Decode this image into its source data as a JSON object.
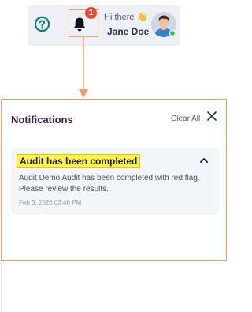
{
  "header": {
    "greeting": "Hi there",
    "user_name": "Jane Doe",
    "notification_count": "1",
    "presence_color": "#2ebf5a",
    "icons": [
      "help-circle-icon",
      "bell-icon",
      "avatar"
    ]
  },
  "notifications": {
    "title": "Notifications",
    "clear_all": "Clear All",
    "items": [
      {
        "title": "Audit has been completed",
        "body": "Audit Demo Audit has been completed with red flag. Please review the results.",
        "time": "Feb 3, 2026 03:46 PM"
      }
    ]
  },
  "colors": {
    "accent": "#f5a066",
    "highlight": "#fff24d",
    "badge": "#e24b36",
    "title": "#3a1f4d"
  }
}
